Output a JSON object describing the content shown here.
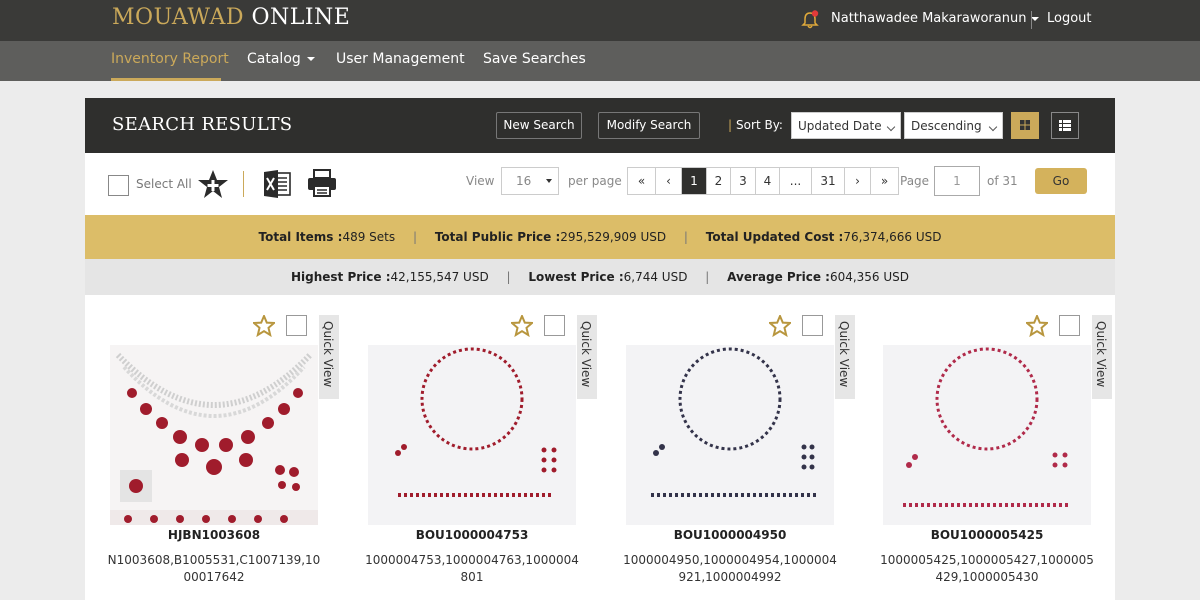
{
  "brand": {
    "part1": "MOUAWAD",
    "part2": "ONLINE"
  },
  "user": {
    "name": "Natthawadee Makaraworanun",
    "logout": "Logout"
  },
  "nav": {
    "items": [
      {
        "label": "Inventory Report"
      },
      {
        "label": "Catalog"
      },
      {
        "label": "User Management"
      },
      {
        "label": "Save Searches"
      }
    ]
  },
  "header": {
    "title": "SEARCH RESULTS",
    "new_search": "New Search",
    "modify_search": "Modify Search",
    "sort_by_label": "Sort By:",
    "sort_field": "Updated Date",
    "sort_order": "Descending"
  },
  "toolbar": {
    "select_all": "Select All",
    "view_label": "View",
    "per_page_value": "16",
    "per_page_label": "per page",
    "pages": [
      "«",
      "‹",
      "1",
      "2",
      "3",
      "4",
      "...",
      "31",
      "›",
      "»"
    ],
    "page_label": "Page",
    "page_input": "1",
    "of_label": "of 31",
    "go": "Go"
  },
  "stats": {
    "total_items_label": "Total Items :",
    "total_items_value": "489 Sets",
    "total_public_label": "Total Public Price :",
    "total_public_value": "295,529,909 USD",
    "total_cost_label": "Total Updated Cost :",
    "total_cost_value": "76,374,666 USD",
    "highest_label": "Highest Price :",
    "highest_value": "42,155,547 USD",
    "lowest_label": "Lowest Price :",
    "lowest_value": "6,744 USD",
    "average_label": "Average Price :",
    "average_value": "604,356 USD"
  },
  "quick_view": "Quick View",
  "cards": [
    {
      "code": "HJBN1003608",
      "desc": "N1003608,B1005531,C1007139,1000017642"
    },
    {
      "code": "BOU1000004753",
      "desc": "1000004753,1000004763,1000004801"
    },
    {
      "code": "BOU1000004950",
      "desc": "1000004950,1000004954,1000004921,1000004992"
    },
    {
      "code": "BOU1000005425",
      "desc": "1000005425,1000005427,1000005429,1000005430"
    }
  ],
  "colors": {
    "gold": "#cba95a",
    "dark": "#2f2f2d",
    "topbar": "#3a3a38",
    "navbar": "#5e5e5c",
    "ruby": "#a01c2c"
  }
}
